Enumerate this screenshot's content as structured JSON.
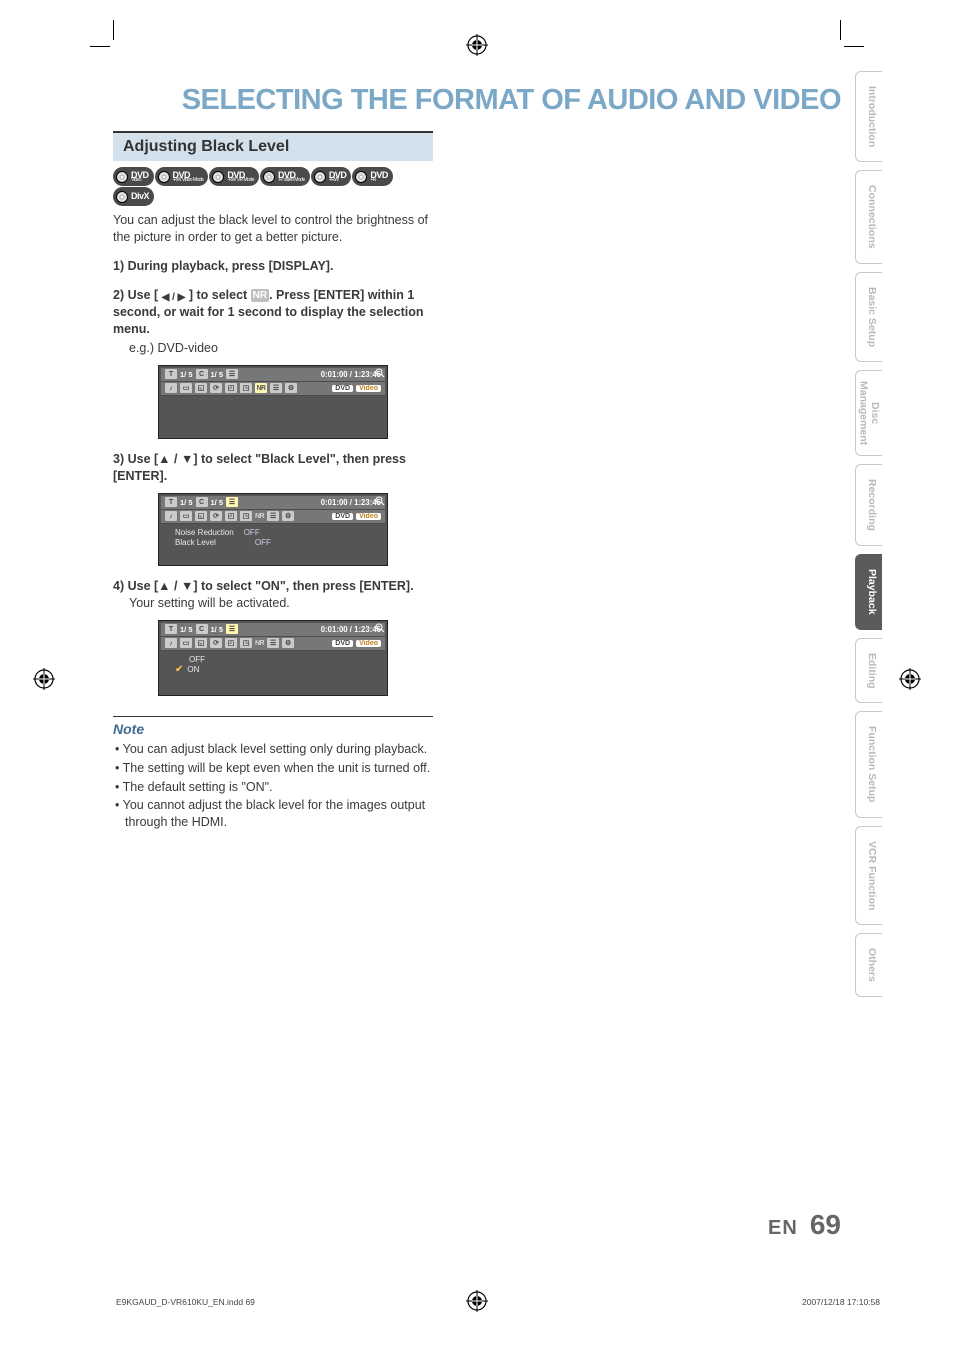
{
  "page_title": "SELECTING THE FORMAT OF AUDIO AND VIDEO",
  "section_header": "Adjusting Black Level",
  "media_badges": [
    {
      "main": "DVD",
      "sub": "Video"
    },
    {
      "main": "DVD",
      "sub": "-RW Video Mode"
    },
    {
      "main": "DVD",
      "sub": "-RW VR Mode"
    },
    {
      "main": "DVD",
      "sub": "-R Video Mode"
    },
    {
      "main": "DVD",
      "sub": "+RW"
    },
    {
      "main": "DVD",
      "sub": "+R"
    },
    {
      "main": "DivX",
      "sub": ""
    }
  ],
  "intro": "You can adjust the black level to control the brightness of the picture in order to get a better picture.",
  "steps": {
    "s1": "1) During playback, press [DISPLAY].",
    "s2a": "2) Use [ ",
    "s2b": " ] to select ",
    "s2c": ". Press [ENTER] within  1 second, or wait for 1 second to display the selection menu.",
    "s2_eg": "e.g.) DVD-video",
    "s3": "3) Use [▲ / ▼] to select \"Black Level\", then press [ENTER].",
    "s4": "4) Use [▲ / ▼] to select \"ON\", then press [ENTER].",
    "s4_sub": "Your setting will be activated."
  },
  "nr_label": "NR",
  "arrow_lr": "◀ / ▶",
  "osd": {
    "t_icon": "T",
    "c_icon": "C",
    "ch_icon": "☰",
    "track": "1/   5",
    "chapter": "1/   5",
    "time": "0:01:00 / 1:23:45",
    "nr": "NR",
    "dvd": "DVD",
    "video": "Video",
    "noise_reduction_label": "Noise Reduction",
    "noise_reduction_value": "OFF",
    "black_level_label": "Black Level",
    "black_level_value": "OFF",
    "opt_off": "OFF",
    "opt_on": "ON"
  },
  "note_title": "Note",
  "notes": [
    "You can adjust black level setting only during playback.",
    "The setting will be kept even when the unit is turned off.",
    "The default setting is \"ON\".",
    "You cannot adjust the black level for the images output through the HDMI."
  ],
  "tabs": [
    "Introduction",
    "Connections",
    "Basic Setup",
    "Disc Management",
    "Recording",
    "Playback",
    "Editing",
    "Function Setup",
    "VCR Function",
    "Others"
  ],
  "footer": {
    "lang": "EN",
    "page": "69"
  },
  "print": {
    "file": "E9KGAUD_D-VR610KU_EN.indd   69",
    "ts": "2007/12/18   17:10:58"
  }
}
